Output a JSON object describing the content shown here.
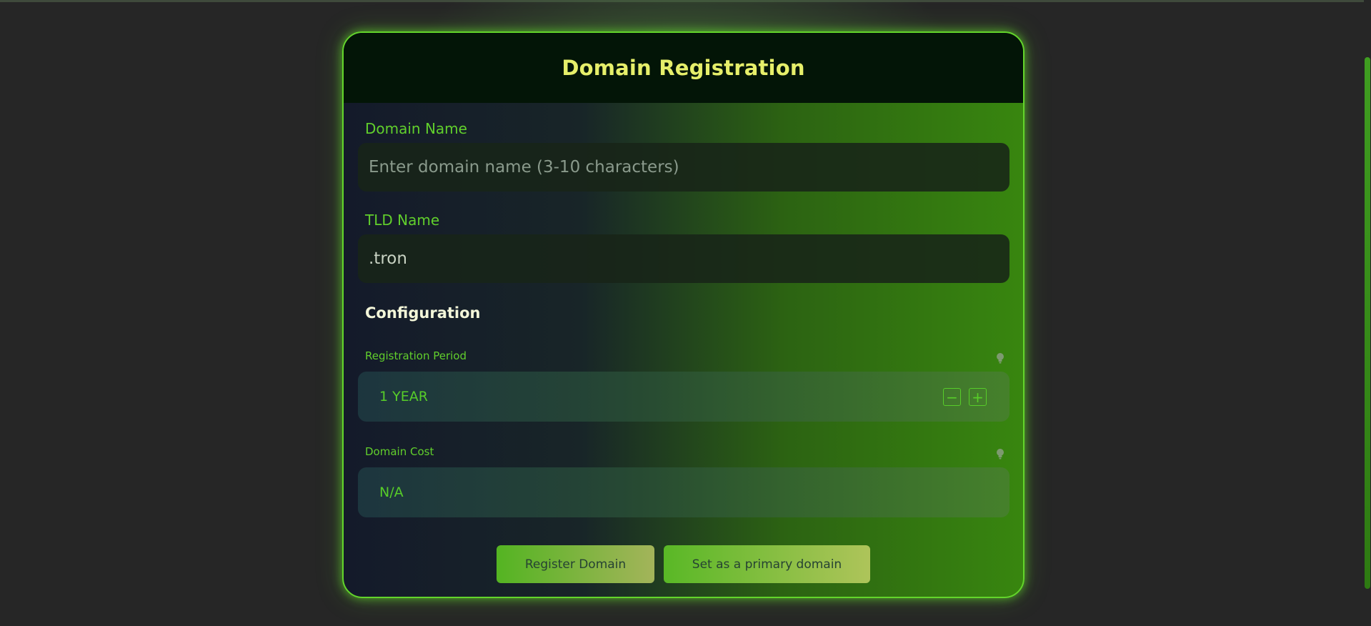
{
  "form": {
    "title": "Domain Registration",
    "domain_name": {
      "label": "Domain Name",
      "placeholder": "Enter domain name (3-10 characters)",
      "value": ""
    },
    "tld_name": {
      "label": "TLD Name",
      "value": ".tron"
    },
    "configuration": {
      "title": "Configuration",
      "registration_period": {
        "label": "Registration Period",
        "value": "1 YEAR",
        "decrement_symbol": "−",
        "increment_symbol": "+",
        "info_icon": "lightbulb-icon"
      },
      "domain_cost": {
        "label": "Domain Cost",
        "value": "N/A",
        "info_icon": "lightbulb-icon"
      }
    },
    "buttons": {
      "register": "Register Domain",
      "set_primary": "Set as a primary domain"
    }
  },
  "colors": {
    "accent": "#63d52b",
    "title": "#e6ef6a",
    "header_bg": "#031507",
    "page_bg": "#262626"
  }
}
